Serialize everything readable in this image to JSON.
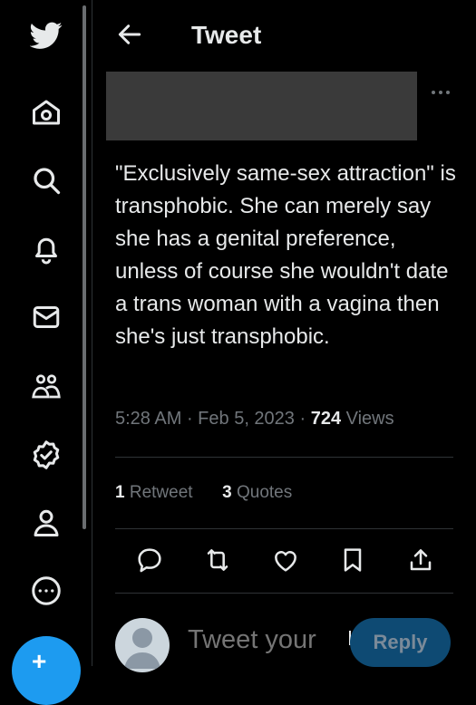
{
  "header": {
    "title": "Tweet",
    "back_icon": "arrow-left-icon"
  },
  "sidebar": {
    "items": [
      {
        "icon": "twitter-logo-icon"
      },
      {
        "icon": "home-icon"
      },
      {
        "icon": "search-icon"
      },
      {
        "icon": "bell-icon"
      },
      {
        "icon": "mail-icon"
      },
      {
        "icon": "communities-icon"
      },
      {
        "icon": "verified-icon"
      },
      {
        "icon": "profile-icon"
      },
      {
        "icon": "more-circle-icon"
      }
    ],
    "compose_icon": "compose-tweet-icon"
  },
  "tweet": {
    "text": "\"Exclusively same-sex attraction\" is transphobic. She can merely say she has a genital preference, unless of course she wouldn't date a trans woman with a vagina then she's just transphobic.",
    "time": "5:28 AM",
    "sep1": " · ",
    "date": "Feb 5, 2023",
    "sep2": " · ",
    "views_count": "724",
    "views_label": " Views",
    "retweets_count": "1",
    "retweets_label": " Retweet",
    "quotes_count": "3",
    "quotes_label": " Quotes"
  },
  "reply": {
    "placeholder": "Tweet your",
    "button_label": "Reply"
  },
  "colors": {
    "accent": "#1d9bf0",
    "text": "#e7e9ea",
    "muted": "#71767b",
    "divider": "#2f3336"
  }
}
